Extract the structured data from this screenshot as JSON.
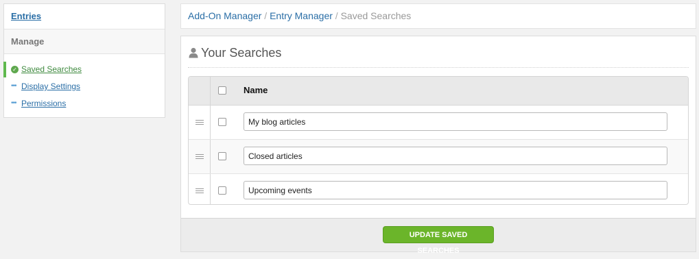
{
  "sidebar": {
    "entries_label": "Entries",
    "manage_label": "Manage",
    "items": [
      {
        "label": "Saved Searches",
        "icon": "check-circle-icon"
      },
      {
        "label": "Display Settings",
        "icon": "dots-icon"
      },
      {
        "label": "Permissions",
        "icon": "dots-icon"
      }
    ]
  },
  "breadcrumb": {
    "crumbs": [
      "Add-On Manager",
      "Entry Manager"
    ],
    "separator": "/",
    "current": "Saved Searches"
  },
  "panel": {
    "title": "Your Searches",
    "title_icon": "user-icon",
    "column_name": "Name",
    "rows": [
      {
        "value": "My blog articles"
      },
      {
        "value": "Closed articles"
      },
      {
        "value": "Upcoming events"
      }
    ],
    "button_label": "UPDATE SAVED SEARCHES"
  },
  "colors": {
    "link": "#2a6ea6",
    "active_green": "#5fb94e",
    "button_green": "#6bb52a"
  }
}
